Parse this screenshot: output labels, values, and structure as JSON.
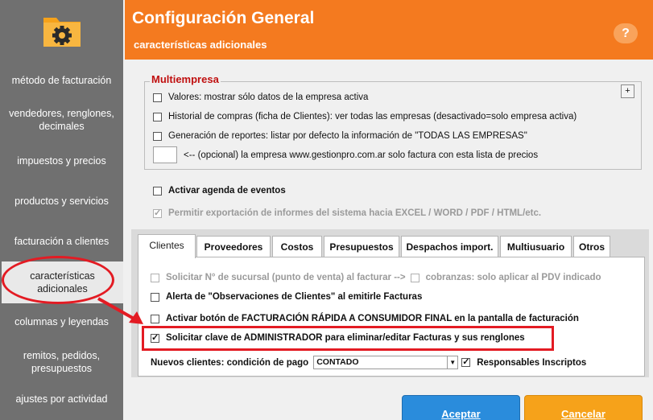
{
  "sidebar": {
    "items": [
      {
        "label": "método de facturación"
      },
      {
        "label": "vendedores, renglones, decimales"
      },
      {
        "label": "impuestos y precios"
      },
      {
        "label": "productos y servicios"
      },
      {
        "label": "facturación a clientes"
      },
      {
        "label": "características adicionales"
      },
      {
        "label": "columnas y leyendas"
      },
      {
        "label": "remitos, pedidos, presupuestos"
      },
      {
        "label": "ajustes por actividad"
      }
    ],
    "icon": "folder-gear-icon"
  },
  "header": {
    "title": "Configuración General",
    "subtitle": "características adicionales",
    "help_label": "?"
  },
  "multiempresa": {
    "legend": "Multiempresa",
    "plus_label": "+",
    "options": [
      {
        "label": "Valores: mostrar sólo datos de la empresa activa",
        "checked": false
      },
      {
        "label": "Historial de compras (ficha de Clientes): ver todas las empresas (desactivado=solo empresa activa)",
        "checked": false
      },
      {
        "label": "Generación de reportes: listar por defecto la información de \"TODAS LAS EMPRESAS\"",
        "checked": false
      }
    ],
    "price_list_value": "",
    "price_list_label": "<-- (opcional) la empresa www.gestionpro.com.ar solo factura con esta lista de precios"
  },
  "general": {
    "agenda_label": "Activar agenda de eventos",
    "agenda_checked": false,
    "export_label": "Permitir exportación de informes del sistema hacia EXCEL / WORD / PDF / HTML/etc.",
    "export_checked": true
  },
  "tabs": [
    {
      "label": "Clientes",
      "active": true
    },
    {
      "label": "Proveedores"
    },
    {
      "label": "Costos"
    },
    {
      "label": "Presupuestos"
    },
    {
      "label": "Despachos import."
    },
    {
      "label": "Multiusuario"
    },
    {
      "label": "Otros"
    }
  ],
  "clientes": {
    "sucursal_label": "Solicitar N° de sucursal (punto de venta) al facturar  -->",
    "cobranzas_label": "cobranzas: solo aplicar al PDV indicado",
    "alerta_label": "Alerta de \"Observaciones de Clientes\" al emitirle Facturas",
    "rapida_label": "Activar botón de FACTURACIÓN RÁPIDA A CONSUMIDOR FINAL en la pantalla de facturación",
    "clave_label": "Solicitar clave de ADMINISTRADOR para eliminar/editar Facturas y sus renglones",
    "clave_checked": true,
    "nuevos_label": "Nuevos clientes: condición de pago",
    "condicion_value": "CONTADO",
    "responsables_label": "Responsables Inscriptos",
    "responsables_checked": true
  },
  "buttons": {
    "aceptar": "Aceptar",
    "cancelar": "Cancelar"
  },
  "colors": {
    "header": "#f47a1f",
    "sidebar": "#707070",
    "accept": "#2a8cdc",
    "cancel": "#f6a21a",
    "annotation": "#e31b23"
  }
}
